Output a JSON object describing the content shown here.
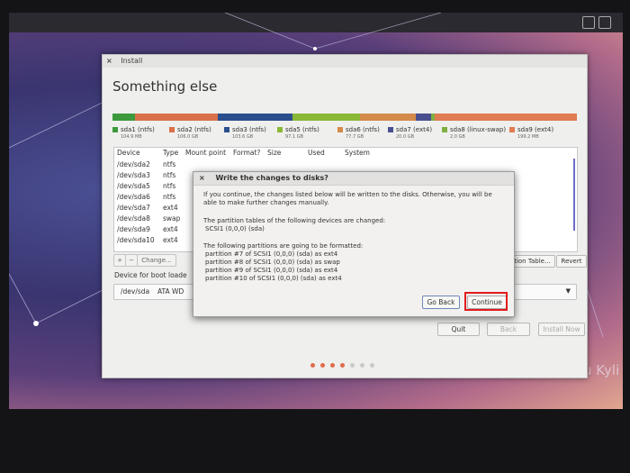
{
  "window": {
    "title": "Install",
    "close_glyph": "×"
  },
  "page": {
    "heading": "Something else"
  },
  "partition_bar": {
    "segments": [
      {
        "name": "sda1",
        "color": "#3c9a3c",
        "weight": 6
      },
      {
        "name": "sda2",
        "color": "#d9704a",
        "weight": 22
      },
      {
        "name": "sda3",
        "color": "#2b4f8e",
        "weight": 20
      },
      {
        "name": "sda5",
        "color": "#8ab837",
        "weight": 18
      },
      {
        "name": "sda6",
        "color": "#d38a4a",
        "weight": 15
      },
      {
        "name": "sda7",
        "color": "#4a4f8f",
        "weight": 4
      },
      {
        "name": "sda8",
        "color": "#7fae40",
        "weight": 1
      },
      {
        "name": "sda9",
        "color": "#e07b52",
        "weight": 38
      }
    ]
  },
  "legend": [
    {
      "label": "sda1 (ntfs)",
      "size": "104.9 MB",
      "color": "#3c9a3c"
    },
    {
      "label": "sda2 (ntfs)",
      "size": "106.0 GB",
      "color": "#d9704a"
    },
    {
      "label": "sda3 (ntfs)",
      "size": "103.6 GB",
      "color": "#2b4f8e"
    },
    {
      "label": "sda5 (ntfs)",
      "size": "97.1 GB",
      "color": "#8ab837"
    },
    {
      "label": "sda6 (ntfs)",
      "size": "77.7 GB",
      "color": "#d38a4a"
    },
    {
      "label": "sda7 (ext4)",
      "size": "20.0 GB",
      "color": "#4a4f8f"
    },
    {
      "label": "sda8 (linux-swap)",
      "size": "2.0 GB",
      "color": "#7fae40"
    },
    {
      "label": "sda9 (ext4)",
      "size": "199.2 MB",
      "color": "#e07b52"
    }
  ],
  "table": {
    "columns": [
      "Device",
      "Type",
      "Mount point",
      "Format?",
      "Size",
      "Used",
      "System"
    ],
    "rows": [
      {
        "device": "/dev/sda2",
        "type": "ntfs"
      },
      {
        "device": "/dev/sda3",
        "type": "ntfs"
      },
      {
        "device": "/dev/sda5",
        "type": "ntfs"
      },
      {
        "device": "/dev/sda6",
        "type": "ntfs"
      },
      {
        "device": "/dev/sda7",
        "type": "ext4"
      },
      {
        "device": "/dev/sda8",
        "type": "swap"
      },
      {
        "device": "/dev/sda9",
        "type": "ext4"
      },
      {
        "device": "/dev/sda10",
        "type": "ext4"
      }
    ]
  },
  "table_buttons": {
    "add": "+",
    "remove": "−",
    "change": "Change...",
    "new_table": "ction Table...",
    "revert": "Revert"
  },
  "boot_loader": {
    "label": "Device for boot loade",
    "device": "/dev/sda",
    "description": "ATA WD"
  },
  "nav": {
    "quit": "Quit",
    "back": "Back",
    "install": "Install Now"
  },
  "progress": {
    "total_steps": 7,
    "current_step": 4,
    "active_color": "#e06b4a",
    "inactive_color": "#c9c9c9"
  },
  "dialog": {
    "title": "Write the changes to disks?",
    "close_glyph": "×",
    "intro_line1": "If you continue, the changes listed below will be written to the disks. Otherwise, you will be",
    "intro_line2": "able to make further changes manually.",
    "tables_heading": "The partition tables of the following devices are changed:",
    "tables_device": "SCSI1 (0,0,0) (sda)",
    "format_heading": "The following partitions are going to be formatted:",
    "format_items": [
      "partition #7 of SCSI1 (0,0,0) (sda) as ext4",
      "partition #8 of SCSI1 (0,0,0) (sda) as swap",
      "partition #9 of SCSI1 (0,0,0) (sda) as ext4",
      "partition #10 of SCSI1 (0,0,0) (sda) as ext4"
    ],
    "go_back": "Go Back",
    "continue": "Continue",
    "highlight_color": "#e21b1b"
  },
  "desktop": {
    "brand_text": "u Kyli"
  }
}
